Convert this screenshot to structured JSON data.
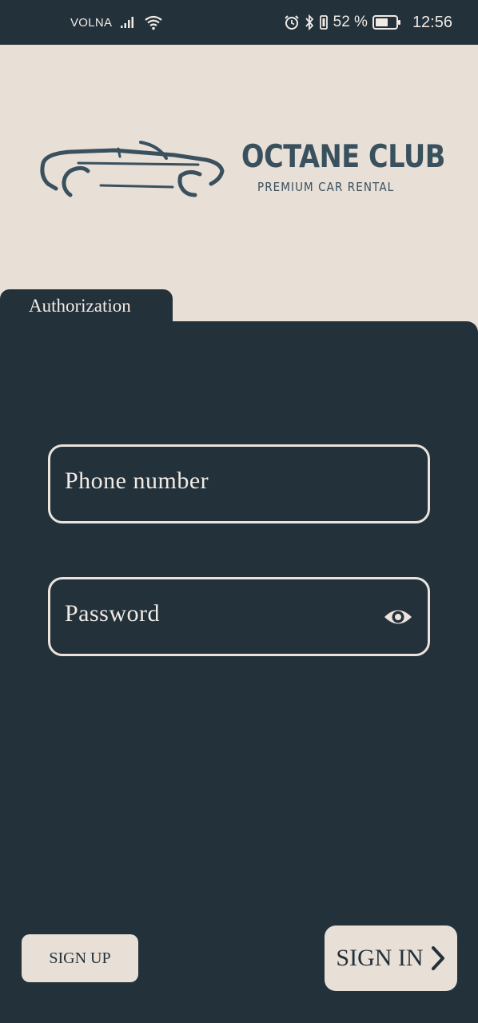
{
  "status_bar": {
    "carrier": "VOLNA",
    "battery_percent": "52 %",
    "time": "12:56",
    "icons": [
      "signal-icon",
      "wifi-icon",
      "alarm-icon",
      "bluetooth-icon",
      "vibrate-icon",
      "battery-icon"
    ]
  },
  "brand": {
    "name": "OCTANE CLUB",
    "tagline": "PREMIUM CAR RENTAL",
    "logo_icon": "convertible-car-icon"
  },
  "auth": {
    "tab_label": "Authorization",
    "phone_placeholder": "Phone number",
    "password_placeholder": "Password",
    "password_toggle_icon": "eye-icon",
    "sign_up_label": "SIGN UP",
    "sign_in_label": "SIGN IN",
    "sign_in_icon": "chevron-right-icon"
  },
  "colors": {
    "panel": "#23313b",
    "background": "#e8dfd6",
    "brand_text": "#39505e",
    "light_text": "#f1ebe5"
  }
}
